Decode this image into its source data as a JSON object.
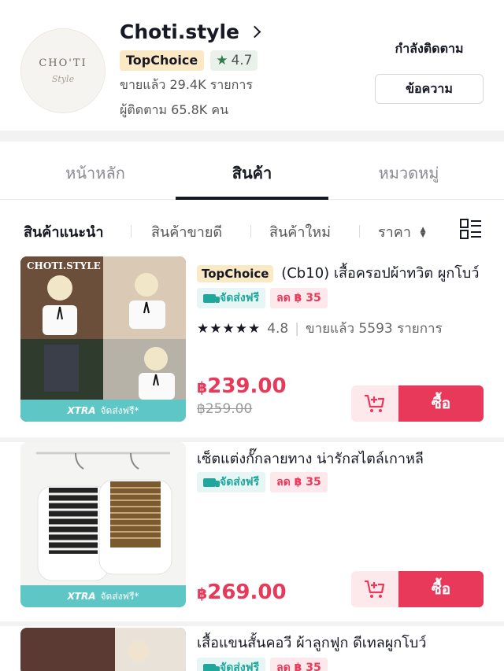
{
  "shop": {
    "logo_text": "CHO'TI",
    "logo_sub": "Style",
    "name": "Choti.style",
    "badge": "TopChoice",
    "rating": "4.7",
    "sold": "ขายแล้ว 29.4K รายการ",
    "followers": "ผู้ติดตาม 65.8K คน",
    "following_label": "กำลังติดตาม",
    "message_label": "ข้อความ"
  },
  "tabs": [
    {
      "label": "หน้าหลัก",
      "active": false
    },
    {
      "label": "สินค้า",
      "active": true
    },
    {
      "label": "หมวดหมู่",
      "active": false
    }
  ],
  "filters": {
    "recommended": "สินค้าแนะนำ",
    "best_selling": "สินค้าขายดี",
    "new": "สินค้าใหม่",
    "price": "ราคา"
  },
  "colors": {
    "accent": "#e8395a",
    "shipping": "#1fa79b",
    "xtra": "#5fc6c6",
    "topchoice_bg": "#fbe9c6"
  },
  "products": [
    {
      "image_brand": "CHOTI.STYLE",
      "badge": "TopChoice",
      "title": "(Cb10) เสื้อครอปผ้าทวิต ผูกโบว์",
      "shipping": "จัดส่งฟรี",
      "discount": "ลด ฿ 35",
      "stars": "★★★★★",
      "rating": "4.8",
      "sold": "ขายแล้ว 5593 รายการ",
      "currency": "฿",
      "price": "239.00",
      "old_price": "฿259.00",
      "xtra": "XTRA",
      "xtra_text": "จัดส่งฟรี*",
      "buy_label": "ซื้อ"
    },
    {
      "title": "เซ็ตแต่งกั๊กลายทาง น่ารักสไตล์เกาหลี",
      "shipping": "จัดส่งฟรี",
      "discount": "ลด ฿ 35",
      "currency": "฿",
      "price": "269.00",
      "xtra": "XTRA",
      "xtra_text": "จัดส่งฟรี*",
      "buy_label": "ซื้อ"
    },
    {
      "title": "เสื้อแขนสั้นคอวี ผ้าลูกฟูก ดีเทลผูกโบว์",
      "shipping": "จัดส่งฟรี",
      "discount": "ลด ฿ 35"
    }
  ]
}
